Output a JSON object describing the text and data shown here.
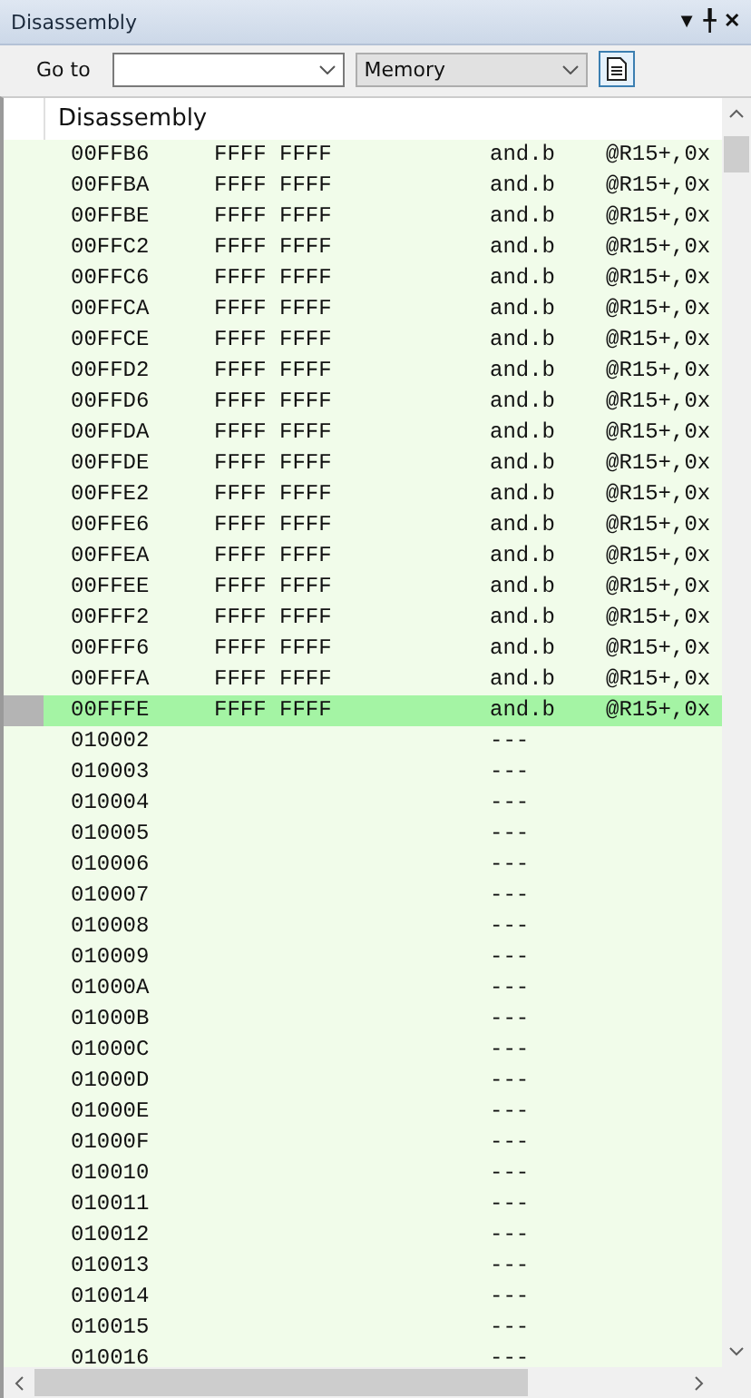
{
  "window": {
    "title": "Disassembly",
    "controls": [
      "▼",
      "╀",
      "✕"
    ]
  },
  "toolbar": {
    "goto_label": "Go to",
    "view_select": "Memory"
  },
  "header": {
    "title": "Disassembly"
  },
  "rows": [
    {
      "address": "00FFB6",
      "code": "FFFF FFFF",
      "mnemonic": "and.b",
      "operand": "@R15+,0x",
      "selected": false
    },
    {
      "address": "00FFBA",
      "code": "FFFF FFFF",
      "mnemonic": "and.b",
      "operand": "@R15+,0x",
      "selected": false
    },
    {
      "address": "00FFBE",
      "code": "FFFF FFFF",
      "mnemonic": "and.b",
      "operand": "@R15+,0x",
      "selected": false
    },
    {
      "address": "00FFC2",
      "code": "FFFF FFFF",
      "mnemonic": "and.b",
      "operand": "@R15+,0x",
      "selected": false
    },
    {
      "address": "00FFC6",
      "code": "FFFF FFFF",
      "mnemonic": "and.b",
      "operand": "@R15+,0x",
      "selected": false
    },
    {
      "address": "00FFCA",
      "code": "FFFF FFFF",
      "mnemonic": "and.b",
      "operand": "@R15+,0x",
      "selected": false
    },
    {
      "address": "00FFCE",
      "code": "FFFF FFFF",
      "mnemonic": "and.b",
      "operand": "@R15+,0x",
      "selected": false
    },
    {
      "address": "00FFD2",
      "code": "FFFF FFFF",
      "mnemonic": "and.b",
      "operand": "@R15+,0x",
      "selected": false
    },
    {
      "address": "00FFD6",
      "code": "FFFF FFFF",
      "mnemonic": "and.b",
      "operand": "@R15+,0x",
      "selected": false
    },
    {
      "address": "00FFDA",
      "code": "FFFF FFFF",
      "mnemonic": "and.b",
      "operand": "@R15+,0x",
      "selected": false
    },
    {
      "address": "00FFDE",
      "code": "FFFF FFFF",
      "mnemonic": "and.b",
      "operand": "@R15+,0x",
      "selected": false
    },
    {
      "address": "00FFE2",
      "code": "FFFF FFFF",
      "mnemonic": "and.b",
      "operand": "@R15+,0x",
      "selected": false
    },
    {
      "address": "00FFE6",
      "code": "FFFF FFFF",
      "mnemonic": "and.b",
      "operand": "@R15+,0x",
      "selected": false
    },
    {
      "address": "00FFEA",
      "code": "FFFF FFFF",
      "mnemonic": "and.b",
      "operand": "@R15+,0x",
      "selected": false
    },
    {
      "address": "00FFEE",
      "code": "FFFF FFFF",
      "mnemonic": "and.b",
      "operand": "@R15+,0x",
      "selected": false
    },
    {
      "address": "00FFF2",
      "code": "FFFF FFFF",
      "mnemonic": "and.b",
      "operand": "@R15+,0x",
      "selected": false
    },
    {
      "address": "00FFF6",
      "code": "FFFF FFFF",
      "mnemonic": "and.b",
      "operand": "@R15+,0x",
      "selected": false
    },
    {
      "address": "00FFFA",
      "code": "FFFF FFFF",
      "mnemonic": "and.b",
      "operand": "@R15+,0x",
      "selected": false
    },
    {
      "address": "00FFFE",
      "code": "FFFF FFFF",
      "mnemonic": "and.b",
      "operand": "@R15+,0x",
      "selected": true
    },
    {
      "address": "010002",
      "mnemonic": "---",
      "selected": false
    },
    {
      "address": "010003",
      "mnemonic": "---",
      "selected": false
    },
    {
      "address": "010004",
      "mnemonic": "---",
      "selected": false
    },
    {
      "address": "010005",
      "mnemonic": "---",
      "selected": false
    },
    {
      "address": "010006",
      "mnemonic": "---",
      "selected": false
    },
    {
      "address": "010007",
      "mnemonic": "---",
      "selected": false
    },
    {
      "address": "010008",
      "mnemonic": "---",
      "selected": false
    },
    {
      "address": "010009",
      "mnemonic": "---",
      "selected": false
    },
    {
      "address": "01000A",
      "mnemonic": "---",
      "selected": false
    },
    {
      "address": "01000B",
      "mnemonic": "---",
      "selected": false
    },
    {
      "address": "01000C",
      "mnemonic": "---",
      "selected": false
    },
    {
      "address": "01000D",
      "mnemonic": "---",
      "selected": false
    },
    {
      "address": "01000E",
      "mnemonic": "---",
      "selected": false
    },
    {
      "address": "01000F",
      "mnemonic": "---",
      "selected": false
    },
    {
      "address": "010010",
      "mnemonic": "---",
      "selected": false
    },
    {
      "address": "010011",
      "mnemonic": "---",
      "selected": false
    },
    {
      "address": "010012",
      "mnemonic": "---",
      "selected": false
    },
    {
      "address": "010013",
      "mnemonic": "---",
      "selected": false
    },
    {
      "address": "010014",
      "mnemonic": "---",
      "selected": false
    },
    {
      "address": "010015",
      "mnemonic": "---",
      "selected": false
    },
    {
      "address": "010016",
      "mnemonic": "---",
      "selected": false
    }
  ]
}
